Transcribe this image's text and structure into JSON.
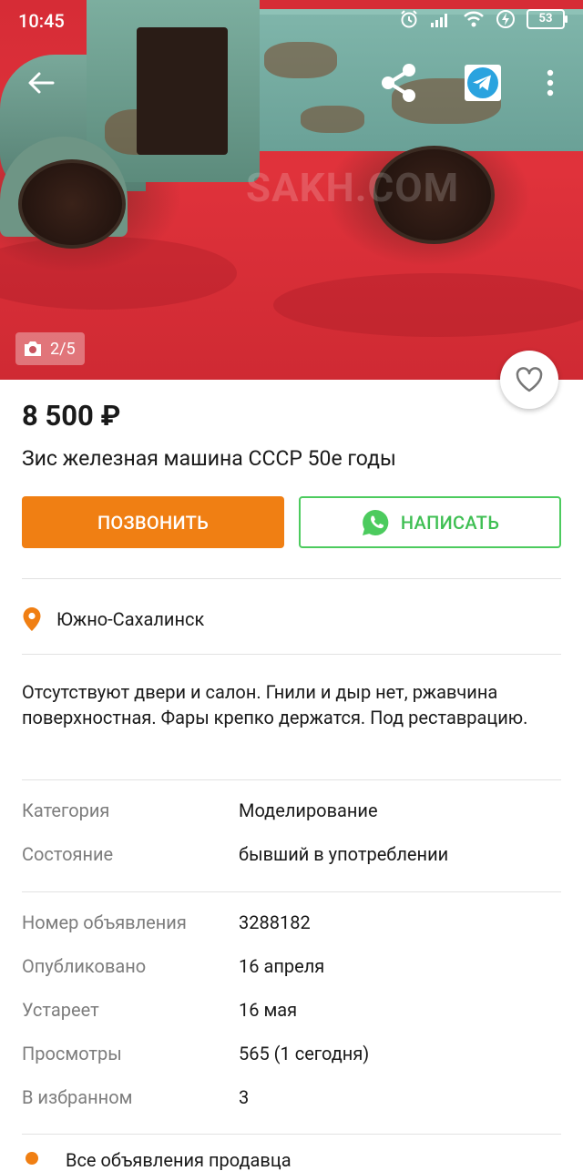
{
  "status_bar": {
    "time": "10:45",
    "battery": "53"
  },
  "toolbar": {
    "back_icon": "arrow-left-icon",
    "share_icon": "share-icon",
    "telegram_icon": "telegram-icon",
    "menu_icon": "more-vertical-icon"
  },
  "gallery": {
    "counter": "2/5",
    "watermark": "SAKH.COM"
  },
  "listing": {
    "price": "8 500 ₽",
    "title": "Зис железная машина СССР 50е годы",
    "call_label": "ПОЗВОНИТЬ",
    "message_label": "НАПИСАТЬ",
    "location": "Южно-Сахалинск",
    "description": "Отсутствуют двери и салон. Гнили и дыр нет, ржавчина поверхностная. Фары крепко держатся. Под реставрацию."
  },
  "details": {
    "category_label": "Категория",
    "category_value": "Моделирование",
    "condition_label": "Состояние",
    "condition_value": "бывший в употреблении",
    "id_label": "Номер объявления",
    "id_value": "3288182",
    "published_label": "Опубликовано",
    "published_value": "16 апреля",
    "expires_label": "Устареет",
    "expires_value": "16 мая",
    "views_label": "Просмотры",
    "views_value": "565 (1 сегодня)",
    "favorites_label": "В избранном",
    "favorites_value": "3"
  },
  "footer": {
    "seller_link": "Все объявления продавца"
  },
  "colors": {
    "accent": "#f07f13",
    "whatsapp": "#4ccb5e",
    "location_pin": "#f07f13"
  }
}
